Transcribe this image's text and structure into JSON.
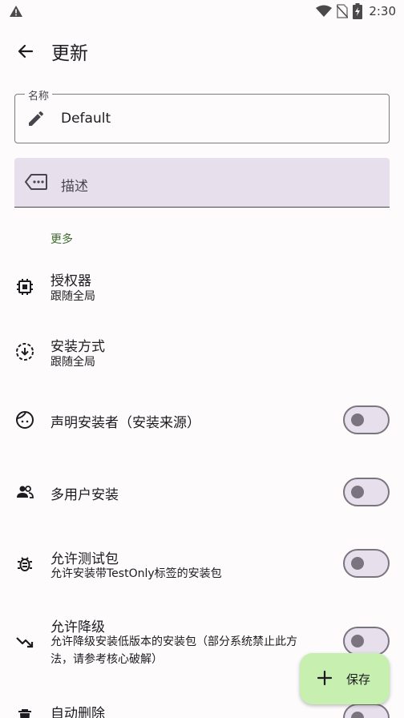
{
  "status_bar": {
    "time": "2:30"
  },
  "app_bar": {
    "title": "更新"
  },
  "name_field": {
    "label": "名称",
    "value": "Default"
  },
  "description_field": {
    "placeholder": "描述"
  },
  "section": {
    "label": "更多"
  },
  "settings": [
    {
      "title": "授权器",
      "subtitle": "跟随全局",
      "icon": "chip-icon"
    },
    {
      "title": "安装方式",
      "subtitle": "跟随全局",
      "icon": "download-circle-icon"
    },
    {
      "title": "声明安装者（安装来源）",
      "icon": "face-icon",
      "toggle": false
    },
    {
      "title": "多用户安装",
      "icon": "people-icon",
      "toggle": false
    },
    {
      "title": "允许测试包",
      "subtitle": "允许安装带TestOnly标签的安装包",
      "icon": "bug-icon",
      "toggle": false
    },
    {
      "title": "允许降级",
      "subtitle_line1": "允许降级安装低版本的安装包（部分系统禁止此方",
      "subtitle_line2": "法，请参考核心破解）",
      "icon": "trending-down-icon",
      "toggle": false
    },
    {
      "title": "自动删除",
      "icon": "delete-icon",
      "toggle": false
    }
  ],
  "fab": {
    "label": "保存"
  },
  "colors": {
    "accent": "#3f6b2e",
    "fab_bg": "#c6efb0",
    "field_fill": "#e7e0ec"
  }
}
